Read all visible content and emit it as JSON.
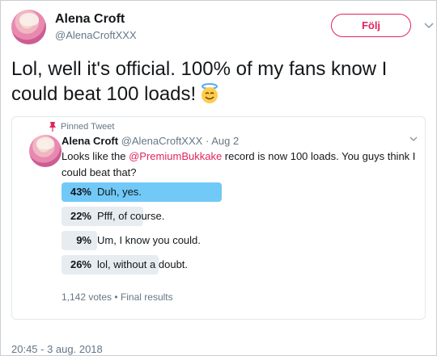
{
  "author": {
    "name": "Alena Croft",
    "handle": "@AlenaCroftXXX"
  },
  "follow_label": "Följ",
  "tweet": {
    "text": "Lol, well it's official. 100% of my fans know I could beat 100 loads!",
    "emoji": "smiling-face-with-halo"
  },
  "quoted": {
    "pinned_label": "Pinned Tweet",
    "name": "Alena Croft",
    "handle": "@AlenaCroftXXX",
    "separator": "·",
    "date": "Aug 2",
    "text_before": "Looks like the ",
    "mention": "@PremiumBukkake",
    "text_after": " record is now 100 loads. You guys think I could beat that?",
    "poll": {
      "choices": [
        {
          "percent": 43,
          "percent_label": "43%",
          "label": "Duh, yes.",
          "winner": true
        },
        {
          "percent": 22,
          "percent_label": "22%",
          "label": "Pfff, of course.",
          "winner": false
        },
        {
          "percent": 9,
          "percent_label": "9%",
          "label": "Um, I know you could.",
          "winner": false
        },
        {
          "percent": 26,
          "percent_label": "26%",
          "label": "lol, without a doubt.",
          "winner": false
        }
      ],
      "votes": "1,142 votes",
      "dot": "•",
      "status": "Final results"
    }
  },
  "timestamp": "20:45 - 3 aug. 2018",
  "colors": {
    "accent": "#e0245e",
    "winner_bar": "#71c9f8",
    "bar": "#e6ecf0",
    "secondary_text": "#657786"
  }
}
